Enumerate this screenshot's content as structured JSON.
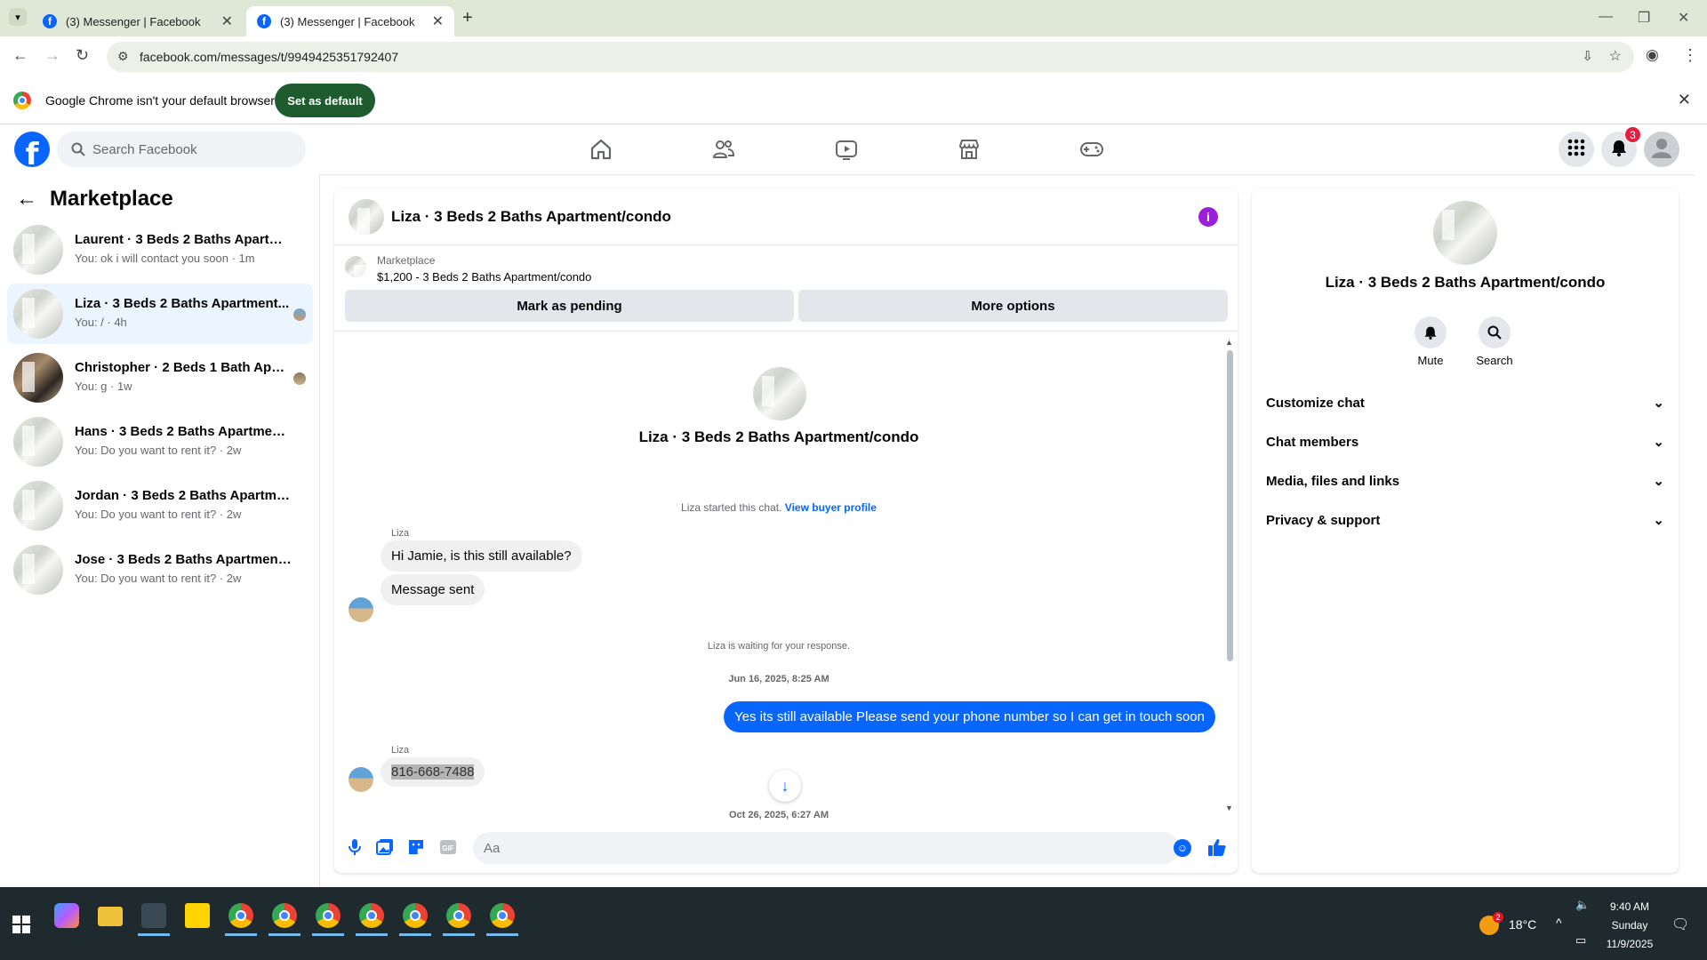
{
  "browser": {
    "tabs": [
      {
        "title": "(3) Messenger | Facebook"
      },
      {
        "title": "(3) Messenger | Facebook"
      }
    ],
    "url": "facebook.com/messages/t/9949425351792407",
    "infobar_text": "Google Chrome isn't your default browser",
    "set_default_label": "Set as default"
  },
  "fb": {
    "search_placeholder": "Search Facebook",
    "notification_count": "3",
    "logo_letter": "f"
  },
  "sidebar": {
    "title": "Marketplace",
    "conversations": [
      {
        "name": "Laurent · 3 Beds 2 Baths Apartmen...",
        "preview": "You: ok i will contact you soon · 1m"
      },
      {
        "name": "Liza · 3 Beds 2 Baths Apartment...",
        "preview": "You: / · 4h"
      },
      {
        "name": "Christopher · 2 Beds 1 Bath Apar...",
        "preview": "You: g · 1w"
      },
      {
        "name": "Hans · 3 Beds 2 Baths Apartment/...",
        "preview": "You: Do you want to rent it? · 2w"
      },
      {
        "name": "Jordan · 3 Beds 2 Baths Apartment...",
        "preview": "You: Do you want to rent it? · 2w"
      },
      {
        "name": "Jose · 3 Beds 2 Baths Apartment/c...",
        "preview": "You: Do you want to rent it? · 2w"
      }
    ]
  },
  "chat": {
    "title": "Liza · 3 Beds 2 Baths Apartment/condo",
    "listing_source": "Marketplace",
    "listing_desc": "$1,200 - 3 Beds 2 Baths Apartment/condo",
    "mark_pending_label": "Mark as pending",
    "more_options_label": "More options",
    "profile_title": "Liza · 3 Beds 2 Baths Apartment/condo",
    "started_note": "Liza started this chat.",
    "view_buyer_label": "View buyer profile",
    "msg1_sender": "Liza",
    "msg1": "Hi Jamie, is this still available?",
    "msg2": "Message sent",
    "waiting_note": "Liza is waiting for your response.",
    "timestamp1": "Jun 16, 2025, 8:25 AM",
    "outgoing": "Yes its still available Please send your phone number so I can get in touch soon",
    "msg3_sender": "Liza",
    "msg3": "816-668-7488",
    "timestamp2": "Oct 26, 2025, 6:27 AM",
    "input_placeholder": "Aa"
  },
  "details": {
    "title": "Liza · 3 Beds 2 Baths Apartment/condo",
    "mute_label": "Mute",
    "search_label": "Search",
    "sections": [
      {
        "label": "Customize chat"
      },
      {
        "label": "Chat members"
      },
      {
        "label": "Media, files and links"
      },
      {
        "label": "Privacy & support"
      }
    ]
  },
  "taskbar": {
    "temperature": "18°C",
    "weather_badge": "2",
    "time": "9:40 AM",
    "day": "Sunday",
    "date": "11/9/2025"
  }
}
